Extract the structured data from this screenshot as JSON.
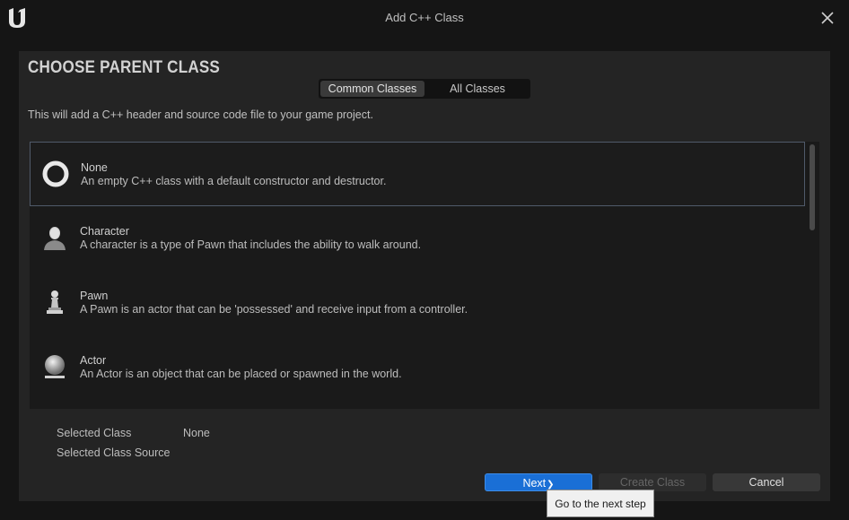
{
  "window": {
    "title": "Add C++ Class",
    "logo_icon": "unreal-engine-logo",
    "close_glyph": "✕"
  },
  "header": {
    "title": "CHOOSE PARENT CLASS",
    "tabs": [
      {
        "label": "Common Classes",
        "active": true
      },
      {
        "label": "All Classes",
        "active": false
      }
    ],
    "description": "This will add a C++ header and source code file to your game project."
  },
  "classes": [
    {
      "name": "None",
      "description": "An empty C++ class with a default constructor and destructor.",
      "icon": "empty-ring-icon",
      "selected": true
    },
    {
      "name": "Character",
      "description": "A character is a type of Pawn that includes the ability to walk around.",
      "icon": "character-icon",
      "selected": false
    },
    {
      "name": "Pawn",
      "description": "A Pawn is an actor that can be 'possessed' and receive input from a controller.",
      "icon": "pawn-icon",
      "selected": false
    },
    {
      "name": "Actor",
      "description": "An Actor is an object that can be placed or spawned in the world.",
      "icon": "actor-sphere-icon",
      "selected": false
    }
  ],
  "selection": {
    "class_label": "Selected Class",
    "class_value": "None",
    "source_label": "Selected Class Source",
    "source_value": ""
  },
  "buttons": {
    "next": "Next",
    "next_glyph": "❯",
    "create": "Create Class",
    "cancel": "Cancel"
  },
  "tooltip": "Go to the next step",
  "colors": {
    "accent": "#1a6fd6",
    "panel": "#242424",
    "background": "#151515"
  }
}
